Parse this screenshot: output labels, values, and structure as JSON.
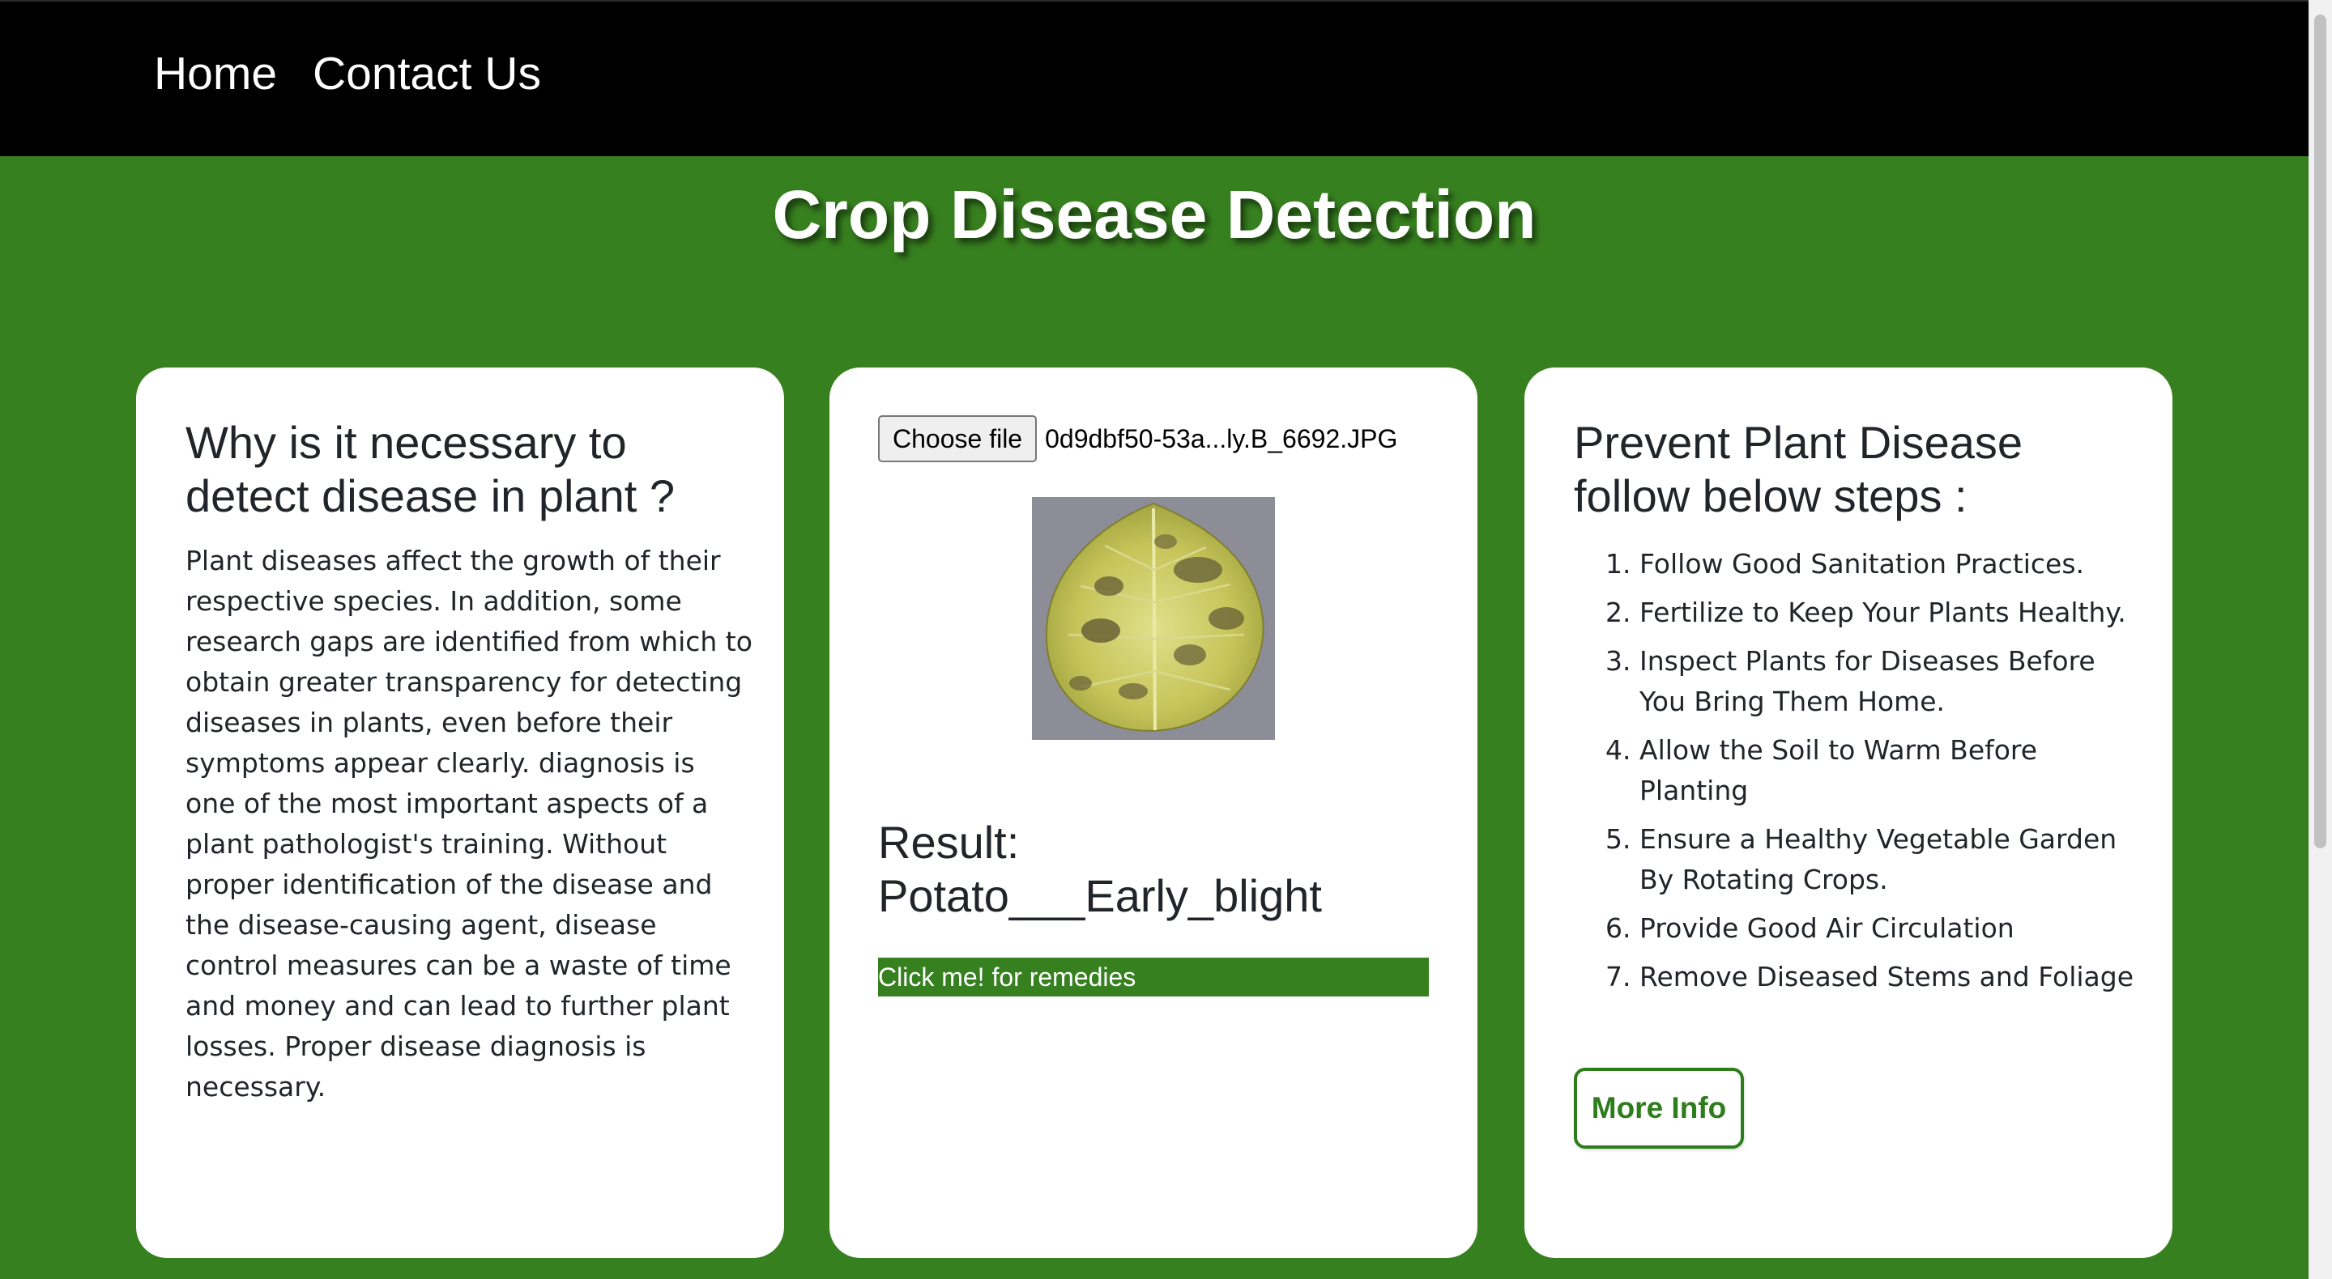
{
  "nav": {
    "home": "Home",
    "contact": "Contact Us"
  },
  "page_title": "Crop Disease Detection",
  "why_card": {
    "heading": "Why is it necessary to detect disease in plant ?",
    "body": "Plant diseases affect the growth of their respective species. In addition, some research gaps are identified from which to obtain greater transparency for detecting diseases in plants, even before their symptoms appear clearly. diagnosis is one of the most important aspects of a plant pathologist's training. Without proper identification of the disease and the disease-causing agent, disease control measures can be a waste of time and money and can lead to further plant losses. Proper disease diagnosis is necessary."
  },
  "upload_card": {
    "choose_file_label": "Choose file",
    "file_name": "0d9dbf50-53a...ly.B_6692.JPG",
    "result_label": "Result:",
    "result_value": "Potato___Early_blight",
    "remedies_label": "Click me! for remedies"
  },
  "prevent_card": {
    "heading": "Prevent Plant Disease follow below steps :",
    "steps": [
      "Follow Good Sanitation Practices.",
      "Fertilize to Keep Your Plants Healthy.",
      "Inspect Plants for Diseases Before You Bring Them Home.",
      "Allow the Soil to Warm Before Planting",
      "Ensure a Healthy Vegetable Garden By Rotating Crops.",
      "Provide Good Air Circulation",
      "Remove Diseased Stems and Foliage"
    ],
    "more_info_label": "More Info"
  },
  "colors": {
    "page_background": "#37801f",
    "nav_background": "#000000",
    "card_background": "#ffffff",
    "accent_green": "#2e7d1c"
  }
}
